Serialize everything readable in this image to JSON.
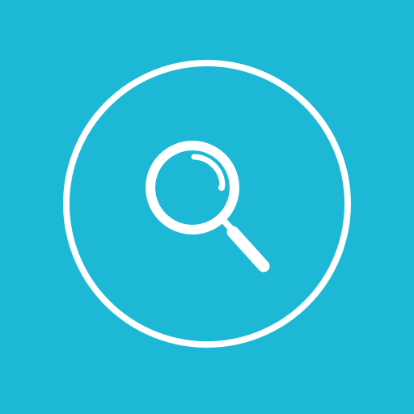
{
  "icon": {
    "name": "search-icon",
    "style": "magnifying glass inside outlined circle",
    "colors": {
      "background": "#1cb8d6",
      "foreground": "#ffffff"
    }
  }
}
